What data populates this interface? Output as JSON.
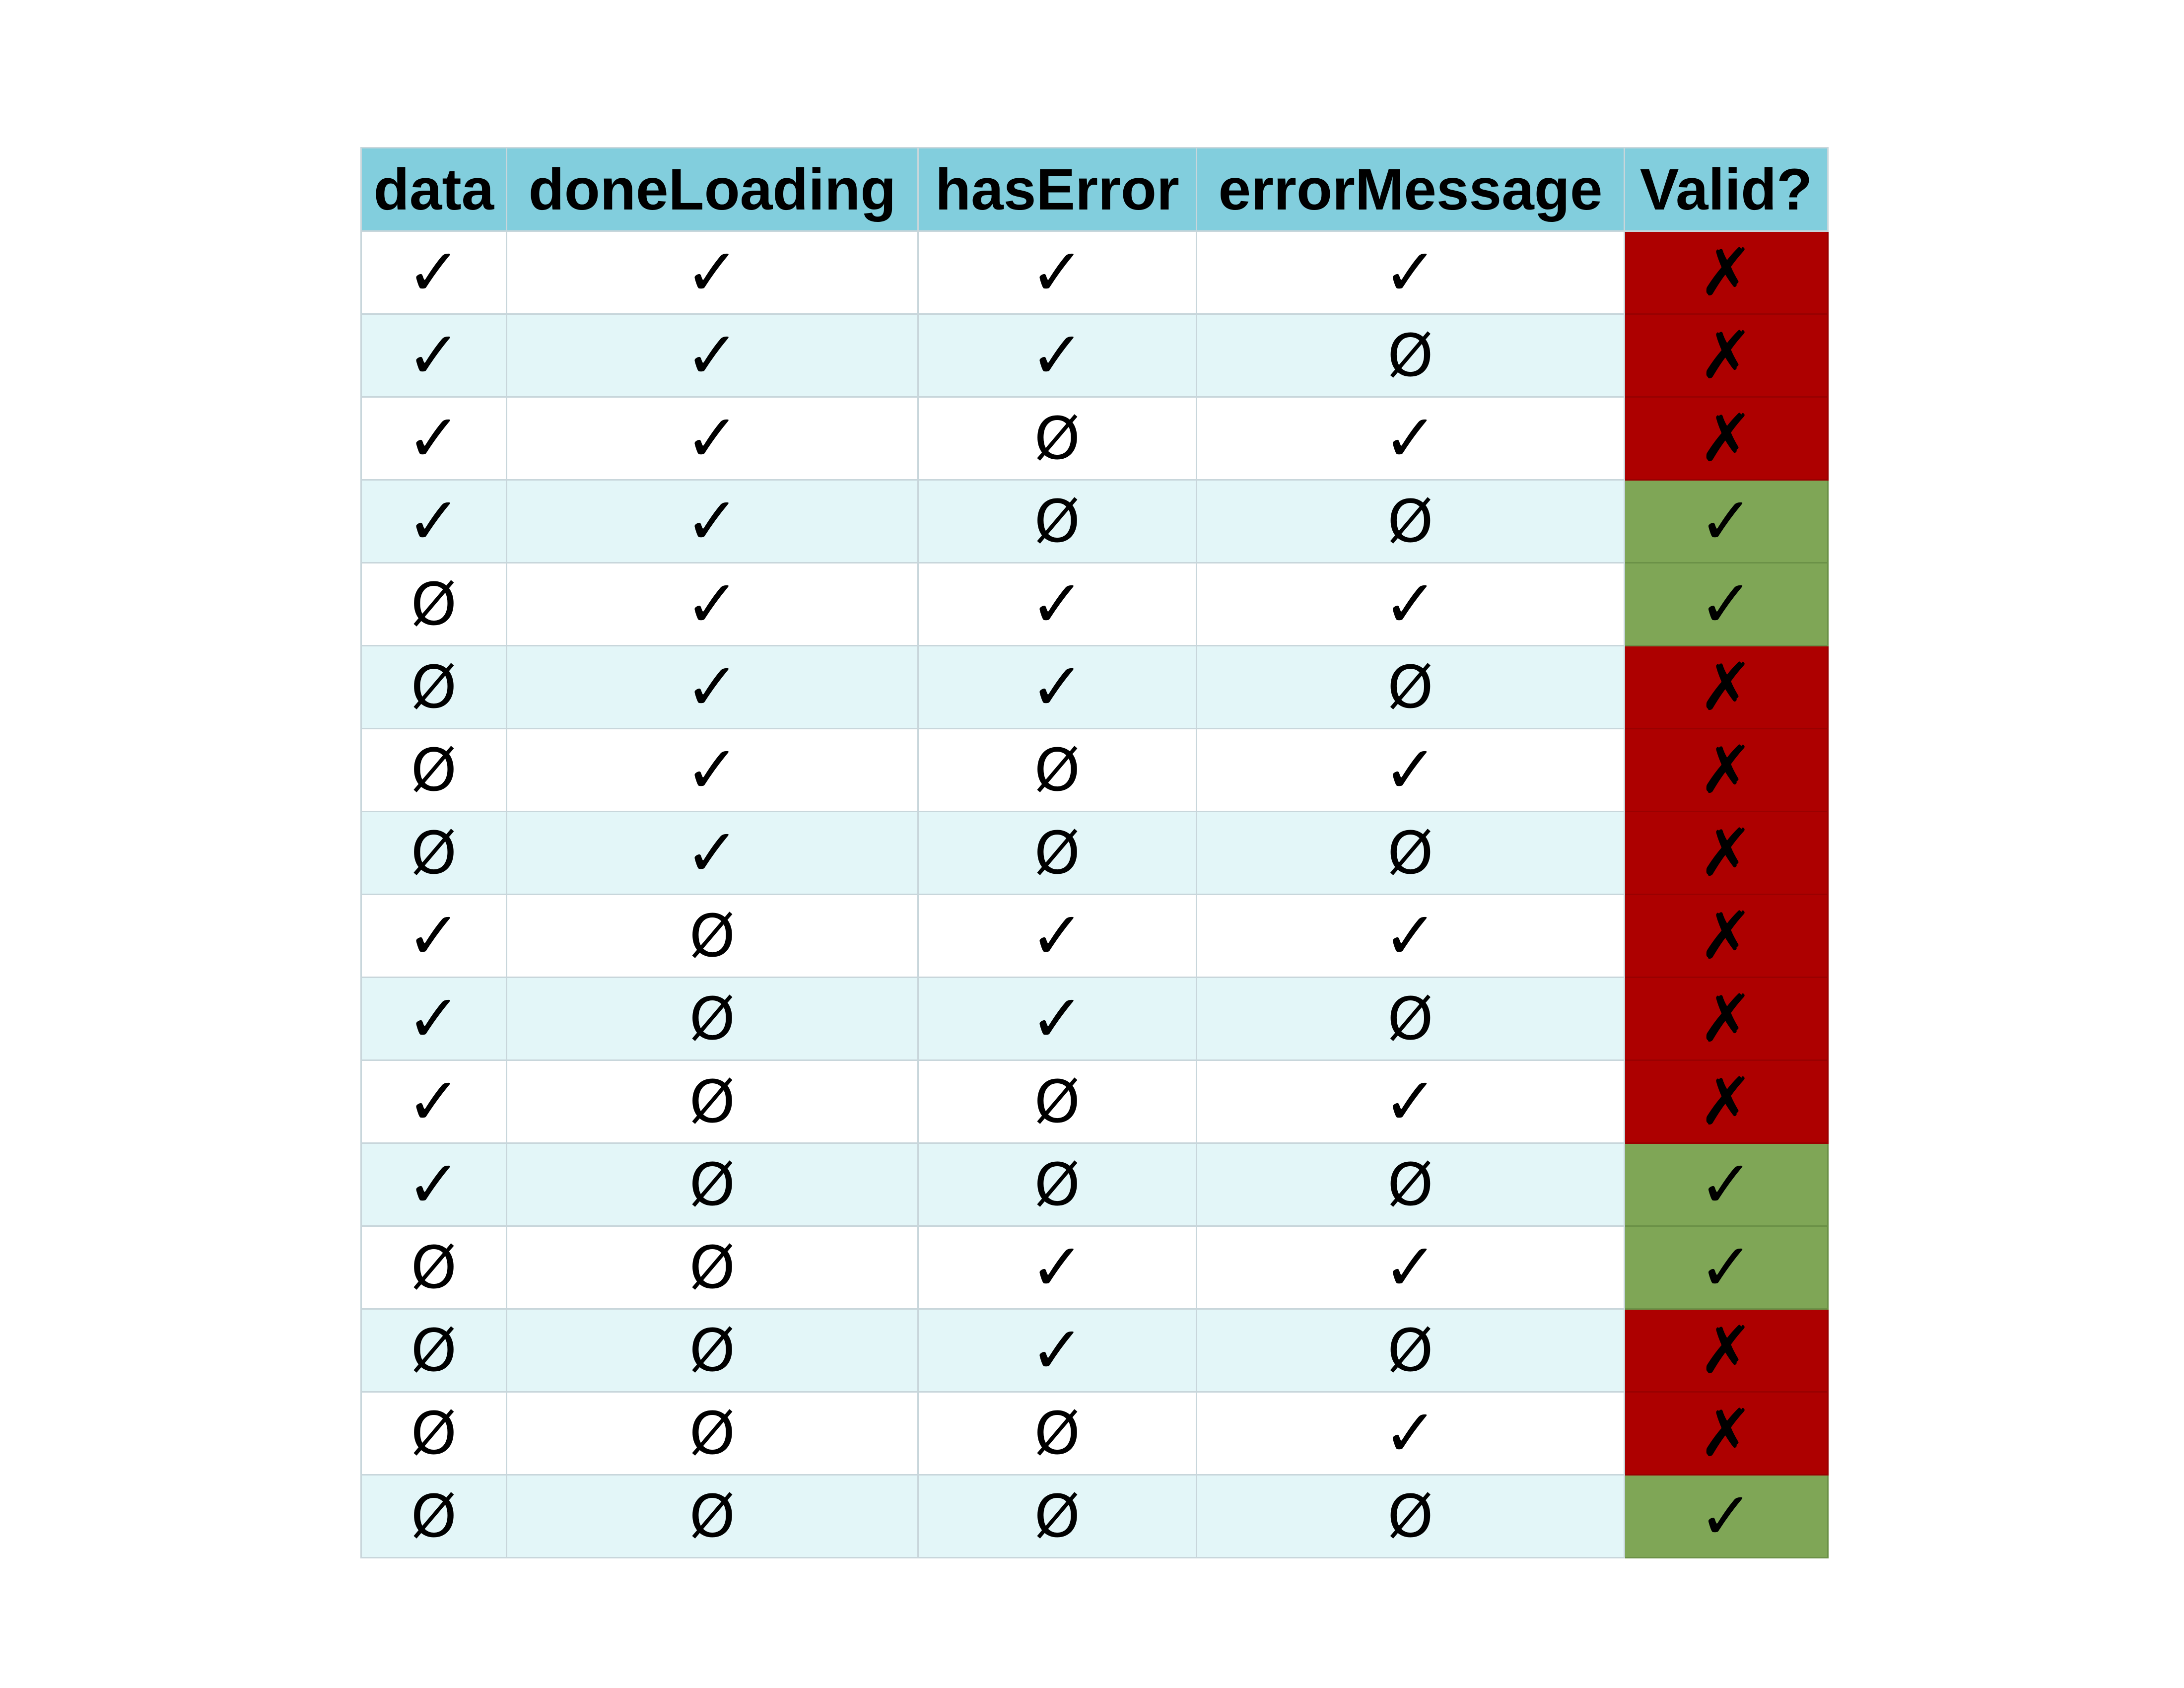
{
  "table": {
    "headers": [
      "data",
      "doneLoading",
      "hasError",
      "errorMessage",
      "Valid?"
    ],
    "symbols": {
      "true": "✓",
      "false": "Ø",
      "invalid": "✗"
    },
    "colors": {
      "header_bg": "#82cedd",
      "row_alt_bg": "#e3f6f8",
      "invalid_bg": "#ad0000",
      "valid_bg": "#7fa656"
    },
    "rows": [
      {
        "data": "✓",
        "doneLoading": "✓",
        "hasError": "✓",
        "errorMessage": "✓",
        "valid": "✗"
      },
      {
        "data": "✓",
        "doneLoading": "✓",
        "hasError": "✓",
        "errorMessage": "Ø",
        "valid": "✗"
      },
      {
        "data": "✓",
        "doneLoading": "✓",
        "hasError": "Ø",
        "errorMessage": "✓",
        "valid": "✗"
      },
      {
        "data": "✓",
        "doneLoading": "✓",
        "hasError": "Ø",
        "errorMessage": "Ø",
        "valid": "✓"
      },
      {
        "data": "Ø",
        "doneLoading": "✓",
        "hasError": "✓",
        "errorMessage": "✓",
        "valid": "✓"
      },
      {
        "data": "Ø",
        "doneLoading": "✓",
        "hasError": "✓",
        "errorMessage": "Ø",
        "valid": "✗"
      },
      {
        "data": "Ø",
        "doneLoading": "✓",
        "hasError": "Ø",
        "errorMessage": "✓",
        "valid": "✗"
      },
      {
        "data": "Ø",
        "doneLoading": "✓",
        "hasError": "Ø",
        "errorMessage": "Ø",
        "valid": "✗"
      },
      {
        "data": "✓",
        "doneLoading": "Ø",
        "hasError": "✓",
        "errorMessage": "✓",
        "valid": "✗"
      },
      {
        "data": "✓",
        "doneLoading": "Ø",
        "hasError": "✓",
        "errorMessage": "Ø",
        "valid": "✗"
      },
      {
        "data": "✓",
        "doneLoading": "Ø",
        "hasError": "Ø",
        "errorMessage": "✓",
        "valid": "✗"
      },
      {
        "data": "✓",
        "doneLoading": "Ø",
        "hasError": "Ø",
        "errorMessage": "Ø",
        "valid": "✓"
      },
      {
        "data": "Ø",
        "doneLoading": "Ø",
        "hasError": "✓",
        "errorMessage": "✓",
        "valid": "✓"
      },
      {
        "data": "Ø",
        "doneLoading": "Ø",
        "hasError": "✓",
        "errorMessage": "Ø",
        "valid": "✗"
      },
      {
        "data": "Ø",
        "doneLoading": "Ø",
        "hasError": "Ø",
        "errorMessage": "✓",
        "valid": "✗"
      },
      {
        "data": "Ø",
        "doneLoading": "Ø",
        "hasError": "Ø",
        "errorMessage": "Ø",
        "valid": "✓"
      }
    ]
  }
}
